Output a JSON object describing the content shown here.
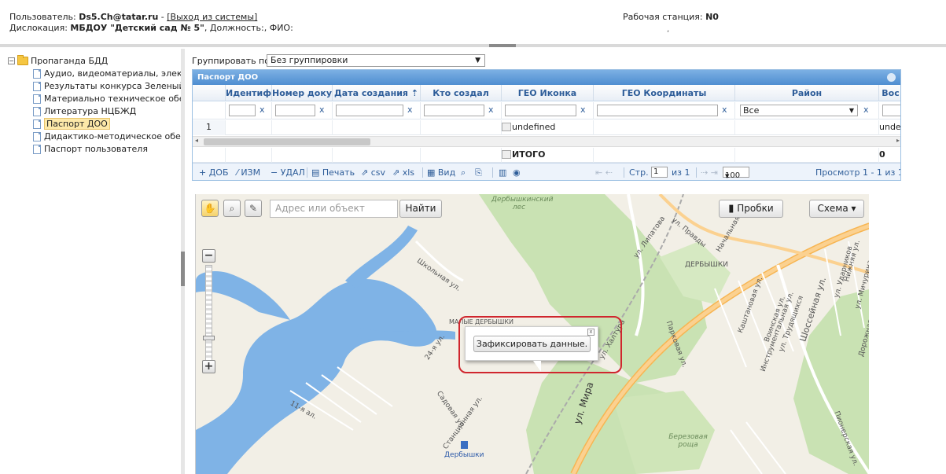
{
  "header": {
    "user_prefix": "Пользователь: ",
    "user": "Ds5.Ch@tatar.ru",
    "user_sep": " - ",
    "logout": "[Выход из системы]",
    "loc_prefix": "Дислокация: ",
    "location": "МБДОУ \"Детский сад № 5\"",
    "loc_suffix": ", Должность:, ФИО:",
    "ws_prefix": "Рабочая станция: ",
    "workstation": "N0",
    "ws_extra": ","
  },
  "tree": {
    "root": "Пропаганда БДД",
    "toggle": "−",
    "items": [
      "Аудио, видеоматериалы, элек",
      "Результаты конкурса Зеленый",
      "Материально техническое обе",
      "Литература НЦБЖД",
      "Паспорт ДОО",
      "Дидактико-методическое обес",
      "Паспорт пользователя"
    ]
  },
  "grouping": {
    "label": "Группировать по:",
    "value": "Без группировки",
    "arrow": "▼"
  },
  "grid": {
    "caption": "Паспорт ДОО",
    "columns": [
      "",
      "Идентиф",
      "Номер доку",
      "Дата создания ⇡",
      "Кто создал",
      "ГЕО Иконка",
      "ГЕО Координаты",
      "Район",
      "Вос"
    ],
    "filter_clear": "x",
    "filter_district": "Все",
    "filter_arrow": "▼",
    "row": {
      "num": "1",
      "geo_icon": "undefined",
      "last": "unde"
    },
    "total": {
      "geo_icon": "ИТОГО",
      "last": "0"
    },
    "pager": {
      "add": "+ ДОБ",
      "edit": "⁄ ИЗМ",
      "del": "− УДАЛ",
      "print": "▤ Печать",
      "csv": "⇗ csv",
      "xls": "⇗ xls",
      "view": "▦ Вид",
      "page_label": "Стр.",
      "page": "1",
      "of": "из 1",
      "per_page": "100",
      "range": "Просмотр 1 - 1 из 1",
      "first_prev": "⇤ ⇠",
      "next_last": "⇢ ⇥",
      "search_icon": "⌕",
      "refresh_icon": "⎘",
      "cols_icon": "▥",
      "info_icon": "◉"
    }
  },
  "map": {
    "search_placeholder": "Адрес или объект",
    "find": "Найти",
    "traffic": "Пробки",
    "traffic_icon": "▮",
    "scheme": "Схема ▾",
    "zoom_in": "+",
    "zoom_out": "−",
    "hand_icon": "✋",
    "magnifier_icon": "⌕",
    "ruler_icon": "✎",
    "balloon_button": "Зафиксировать данные.",
    "balloon_close": "x",
    "labels": {
      "forest": "Дербышкинский лес",
      "derbyshki": "ДЕРБЫШКИ",
      "mira": "ул. Мира",
      "station": "Дербышки",
      "grove": "Березовая роща",
      "malye": "МАЛЫЕ ДЕРБЫШКИ",
      "lipatova": "ул. Липатова",
      "shosseynaya": "Шоссейная ул.",
      "shkolnaya": "Школьная ул.",
      "pravdy": "ул. Правды",
      "parkovaya": "Парковая ул.",
      "kaltsa": "ул. Халтура",
      "ul24": "24-я ул.",
      "sadovaya": "Садовая ул.",
      "stantsionnaya": "Станционная ул.",
      "ul11": "11-я ал.",
      "kashtanovaya": "Каштановая ул.",
      "instrument": "Инструментальная ул.",
      "voinskaya": "Воинская ул.",
      "trudyashchikhsya": "ул. Трудящихся",
      "nachalnaya": "Начальная",
      "udarnikov": "ул. Ударников",
      "nizhnyaya": "Нижняя ул.",
      "michurina": "ул. Мичурина",
      "dorozhnaya": "Дорожная ул.",
      "pionerskaya": "Пионерская ул."
    }
  },
  "colors": {
    "accent": "#4f8ed1",
    "highlight": "#d0262e",
    "water": "#7fb3e6",
    "forest": "#c9e2b3",
    "road": "#f7b552"
  }
}
